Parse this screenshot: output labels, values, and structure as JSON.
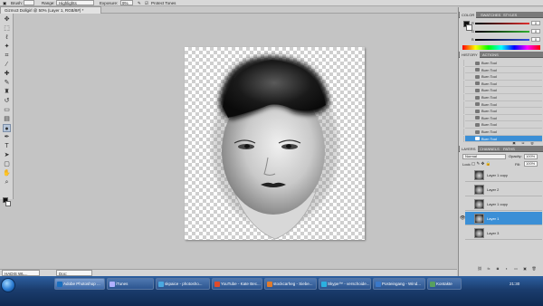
{
  "options_bar": {
    "brush_label": "Brush:",
    "range_label": "Range:",
    "range_value": "Highlights",
    "exposure_label": "Exposure:",
    "exposure_value": "9%",
    "protect_tones": "Protect Tones"
  },
  "document": {
    "tab_title": "Gizmo3 Dollgirl @ 50% (Layer 1, RGB/8#) *"
  },
  "status": {
    "zoom": "HADIS WL...",
    "doc_info": "Doc: 1.40M/11.4M"
  },
  "color_panel": {
    "tabs": [
      "COLOR",
      "SWATCHES",
      "STYLES"
    ],
    "sliders": [
      {
        "label": "R",
        "value": "0",
        "color": "#e03030"
      },
      {
        "label": "G",
        "value": "0",
        "color": "#30b030"
      },
      {
        "label": "B",
        "value": "0",
        "color": "#3050e0"
      }
    ]
  },
  "history_panel": {
    "tabs": [
      "HISTORY",
      "ACTIONS"
    ],
    "items": [
      "Burn Tool",
      "Burn Tool",
      "Burn Tool",
      "Burn Tool",
      "Burn Tool",
      "Burn Tool",
      "Burn Tool",
      "Burn Tool",
      "Burn Tool",
      "Burn Tool",
      "Burn Tool",
      "Burn Tool"
    ],
    "selected_index": 11
  },
  "layers_panel": {
    "tabs": [
      "LAYERS",
      "CHANNELS",
      "PATHS"
    ],
    "blend_mode": "Normal",
    "opacity_label": "Opacity:",
    "opacity_value": "100%",
    "lock_label": "Lock:",
    "fill_label": "Fill:",
    "fill_value": "100%",
    "layers": [
      {
        "name": "Layer 1 copy",
        "visible": false,
        "selected": false
      },
      {
        "name": "Layer 2",
        "visible": false,
        "selected": false
      },
      {
        "name": "Layer 1 copy",
        "visible": false,
        "selected": false
      },
      {
        "name": "Layer 1",
        "visible": true,
        "selected": true
      },
      {
        "name": "Layer 3",
        "visible": false,
        "selected": false
      }
    ]
  },
  "taskbar": {
    "buttons": [
      {
        "label": "Adobe Photoshop ...",
        "color": "#1a6fbf",
        "active": true
      },
      {
        "label": "iTunes",
        "color": "#b0b0ff",
        "active": false
      },
      {
        "label": "skpaice - photosho...",
        "color": "#4aa8e0",
        "active": false
      },
      {
        "label": "YouTube - Kate Bec...",
        "color": "#e04b2b",
        "active": false
      },
      {
        "label": "stockcarheg - Siebe...",
        "color": "#e07b2b",
        "active": false
      },
      {
        "label": "Skype™ - verschoide...",
        "color": "#2bb0e0",
        "active": false
      },
      {
        "label": "Posteingang - Wind...",
        "color": "#3a78c8",
        "active": false
      },
      {
        "label": "Kontakte",
        "color": "#58a060",
        "active": false
      }
    ],
    "clock": "21:30"
  }
}
